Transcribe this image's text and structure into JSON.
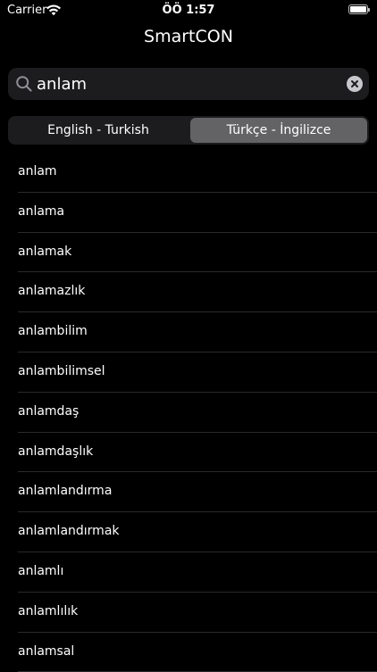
{
  "status_bar": {
    "carrier": "Carrier",
    "time": "ÖÖ 1:57"
  },
  "nav": {
    "title": "SmartCON"
  },
  "search": {
    "value": "anlam",
    "icon": "search-icon",
    "clear_icon": "clear-icon"
  },
  "segments": {
    "items": [
      {
        "label": "English - Turkish",
        "selected": false
      },
      {
        "label": "Türkçe - İngilizce",
        "selected": true
      }
    ]
  },
  "results": [
    "anlam",
    "anlama",
    "anlamak",
    "anlamazlık",
    "anlambilim",
    "anlambilimsel",
    "anlamdaş",
    "anlamdaşlık",
    "anlamlandırma",
    "anlamlandırmak",
    "anlamlı",
    "anlamlılık",
    "anlamsal"
  ],
  "colors": {
    "background": "#000000",
    "field": "#1c1c1e",
    "selected_segment": "#636366",
    "separator": "#2a2a2c",
    "text": "#ffffff"
  }
}
